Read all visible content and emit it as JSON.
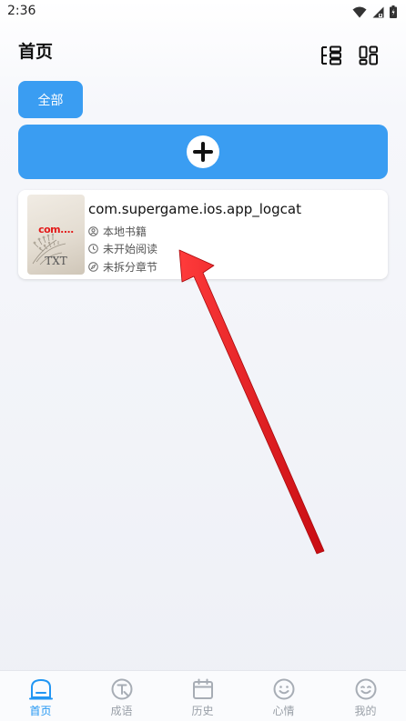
{
  "status_bar": {
    "time": "2:36",
    "icons": [
      "wifi-icon",
      "signal-icon",
      "battery-icon"
    ]
  },
  "header": {
    "title": "首页",
    "actions": [
      "list-view-icon",
      "grid-view-icon"
    ]
  },
  "filter": {
    "selected_label": "全部"
  },
  "add_button": {
    "icon": "plus-icon"
  },
  "books": [
    {
      "title": "com.supergame.ios.app_logcat",
      "cover": {
        "title": "com....",
        "format": "TXT"
      },
      "source": "本地书籍",
      "progress": "未开始阅读",
      "chapters": "未拆分章节"
    }
  ],
  "bottom_nav": {
    "items": [
      {
        "label": "首页",
        "icon": "home-icon",
        "active": true
      },
      {
        "label": "成语",
        "icon": "idiom-icon",
        "active": false
      },
      {
        "label": "历史",
        "icon": "calendar-icon",
        "active": false
      },
      {
        "label": "心情",
        "icon": "smiley-icon",
        "active": false
      },
      {
        "label": "我的",
        "icon": "profile-icon",
        "active": false
      }
    ]
  },
  "colors": {
    "accent": "#3a9df2",
    "nav_active": "#2196f3",
    "nav_inactive": "#9aa0a8",
    "arrow": "#e8141a"
  }
}
